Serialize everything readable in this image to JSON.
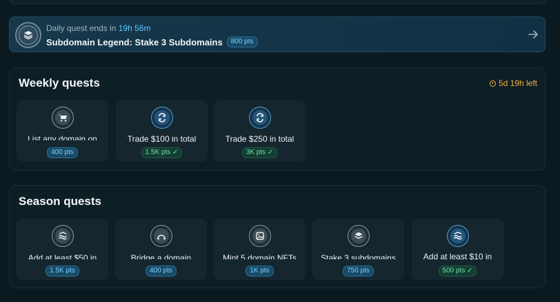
{
  "daily": {
    "prefix": "Daily quest ends in",
    "timer": "19h 56m",
    "title": "Subdomain Legend: Stake 3 Subdomains",
    "points": "800 pts"
  },
  "weekly": {
    "title": "Weekly quests",
    "time_left": "5d 19h left",
    "cards": [
      {
        "label": "List any domain on",
        "points": "400 pts",
        "icon": "cart-icon",
        "completed": false
      },
      {
        "label": "Trade $100 in total",
        "points": "1.5K pts ✓",
        "icon": "swap-icon",
        "completed": true
      },
      {
        "label": "Trade $250 in total",
        "points": "3K pts ✓",
        "icon": "swap-icon",
        "completed": true
      }
    ]
  },
  "season": {
    "title": "Season quests",
    "cards": [
      {
        "label": "Add at least $50 in",
        "points": "1.5K pts",
        "icon": "waves-icon",
        "completed": false
      },
      {
        "label": "Bridge a domain",
        "points": "400 pts",
        "icon": "bridge-icon",
        "completed": false
      },
      {
        "label": "Mint 5 domain NFTs",
        "points": "1K pts",
        "icon": "image-icon",
        "completed": false
      },
      {
        "label": "Stake 3 subdomains",
        "points": "750 pts",
        "icon": "layers-icon",
        "completed": false
      },
      {
        "label": "Add at least $10 in",
        "points": "500 pts ✓",
        "icon": "waves-icon",
        "completed": true
      }
    ]
  },
  "colors": {
    "accent": "#5cc8ff",
    "warning": "#f2b441",
    "success": "#6de3a9"
  }
}
